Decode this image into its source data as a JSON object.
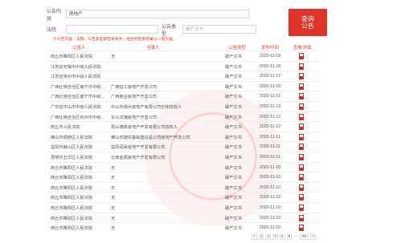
{
  "search": {
    "row1_label": "公告内容",
    "row1_value": "房地产",
    "row2_label": "法院",
    "row2_value": "",
    "type_label": "公告类型",
    "type_value": "破产文书",
    "button_label_1": "查询",
    "button_label_2": "公告"
  },
  "hint": "示公告内容、法院、公告类型等检索条件，组合时检索结果以一组为准。",
  "table": {
    "headers": [
      "公告人",
      "当事人",
      "公告类型",
      "发布时间",
      "查看详细"
    ],
    "rows": [
      {
        "court": "商丘市睢阳区人民法院",
        "party": "无",
        "type": "破产文书",
        "date": "2020-11-18"
      },
      {
        "court": "江苏省无锡市中级人民法院",
        "party": "",
        "type": "破产文书",
        "date": "2020-11-18"
      },
      {
        "court": "江苏省常州市中级人民法院",
        "party": "",
        "type": "破产文书",
        "date": "2020-11-17"
      },
      {
        "court": "广西壮族自治区南宁市中级...",
        "party": "广西钰工房地产开发公司",
        "type": "破产文书",
        "date": "2020-11-16"
      },
      {
        "court": "广西壮族自治区南宁市中级...",
        "party": "广西商业房地产开发公司",
        "type": "破产文书",
        "date": "2020-11-15"
      },
      {
        "court": "广东省中山市中级人民法院",
        "party": "中山市通大房地产有限公司全体债权人",
        "type": "破产文书",
        "date": "2020-11-13"
      },
      {
        "court": "广西壮族自治区钦州市中级...",
        "party": "东兴洋港房地产开发公司",
        "type": "破产文书",
        "date": "2020-11-12"
      },
      {
        "court": "商丘市人民法院",
        "party": "昆山博练房地产开发有限公司债权人",
        "type": "破产文书",
        "date": "2020-11-12"
      },
      {
        "court": "佛山市顺德区人民法院",
        "party": "佛山市捷炫基础建设总公司房地产开发公司",
        "type": "破产文书",
        "date": "2020-11-11"
      },
      {
        "court": "益阳市赫山区人民法院",
        "party": "益阳润昊房地产开发有限公司",
        "type": "破产文书",
        "date": "2020-11-11"
      },
      {
        "court": "昆明市五华区人民法院",
        "party": "云南金鼎房地产开发有限公司",
        "type": "破产文书",
        "date": "2020-11-11"
      },
      {
        "court": "商丘市睢阳区人民法院",
        "party": "无",
        "type": "破产文书",
        "date": "2020-11-10"
      },
      {
        "court": "商丘市睢阳区人民法院",
        "party": "无",
        "type": "破产文书",
        "date": "2020-11-10"
      },
      {
        "court": "商丘市睢阳区人民法院",
        "party": "无",
        "type": "破产文书",
        "date": "2020-11-10"
      },
      {
        "court": "商丘市睢阳区人民法院",
        "party": "无",
        "type": "破产文书",
        "date": "2020-11-10"
      },
      {
        "court": "商丘市睢阳区人民法院",
        "party": "无",
        "type": "破产文书",
        "date": "2020-11-10"
      },
      {
        "court": "商丘市睢阳区人民法院",
        "party": "无",
        "type": "破产文书",
        "date": "2020-11-10"
      },
      {
        "court": "商丘市睢阳区人民法院",
        "party": "无",
        "type": "破产文书",
        "date": "2020-11-10"
      }
    ]
  },
  "pagination": [
    "<",
    "1",
    "2",
    "3",
    "4",
    "5",
    "...",
    "50",
    ">"
  ],
  "colors": {
    "accent": "#e03428",
    "header_text": "#d94a3c"
  }
}
